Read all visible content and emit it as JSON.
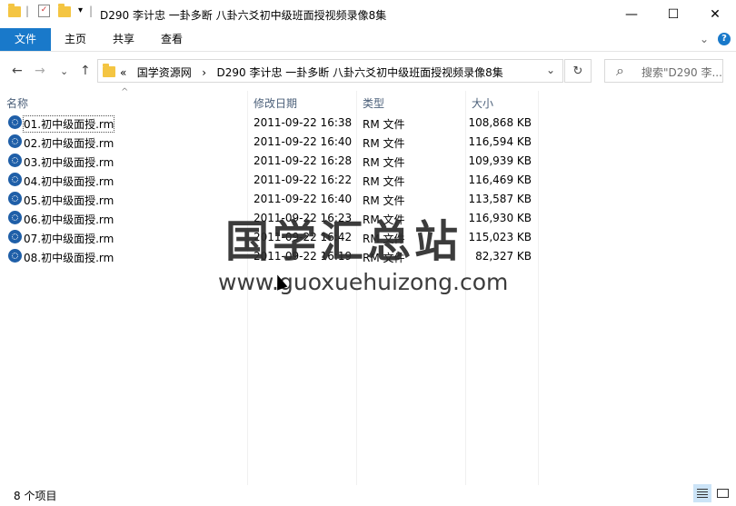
{
  "window": {
    "title": "D290 李计忠 一卦多断 八卦六爻初中级班面授视频录像8集",
    "min_glyph": "—",
    "max_glyph": "☐",
    "close_glyph": "✕"
  },
  "ribbon": {
    "tabs": [
      "文件",
      "主页",
      "共享",
      "查看"
    ],
    "collapse_glyph": "⌄",
    "help_glyph": "?"
  },
  "nav": {
    "back_glyph": "←",
    "forward_glyph": "→",
    "recent_glyph": "⌄",
    "up_glyph": "↑"
  },
  "address": {
    "prefix": "«",
    "crumbs": [
      "国学资源网",
      "D290 李计忠 一卦多断 八卦六爻初中级班面授视频录像8集"
    ],
    "separator": "›",
    "dropdown_glyph": "⌄",
    "refresh_glyph": "↻"
  },
  "search": {
    "placeholder": "搜索\"D290 李...",
    "icon_glyph": "⌕"
  },
  "columns": [
    "名称",
    "修改日期",
    "类型",
    "大小"
  ],
  "files": [
    {
      "name": "01.初中级面授.rm",
      "date": "2011-09-22 16:38",
      "type": "RM 文件",
      "size": "108,868 KB"
    },
    {
      "name": "02.初中级面授.rm",
      "date": "2011-09-22 16:40",
      "type": "RM 文件",
      "size": "116,594 KB"
    },
    {
      "name": "03.初中级面授.rm",
      "date": "2011-09-22 16:28",
      "type": "RM 文件",
      "size": "109,939 KB"
    },
    {
      "name": "04.初中级面授.rm",
      "date": "2011-09-22 16:22",
      "type": "RM 文件",
      "size": "116,469 KB"
    },
    {
      "name": "05.初中级面授.rm",
      "date": "2011-09-22 16:40",
      "type": "RM 文件",
      "size": "113,587 KB"
    },
    {
      "name": "06.初中级面授.rm",
      "date": "2011-09-22 16:23",
      "type": "RM 文件",
      "size": "116,930 KB"
    },
    {
      "name": "07.初中级面授.rm",
      "date": "2011-09-22 16:42",
      "type": "RM 文件",
      "size": "115,023 KB"
    },
    {
      "name": "08.初中级面授.rm",
      "date": "2011-09-22 16:19",
      "type": "RM 文件",
      "size": "82,327 KB"
    }
  ],
  "status": {
    "item_count": "8 个项目"
  },
  "watermark": {
    "title": "国学汇总站",
    "url": "www.guoxuehuizong.com"
  },
  "colors": {
    "accent": "#1979ca",
    "file_icon": "#1f5fa8",
    "header_text": "#4c607a"
  }
}
